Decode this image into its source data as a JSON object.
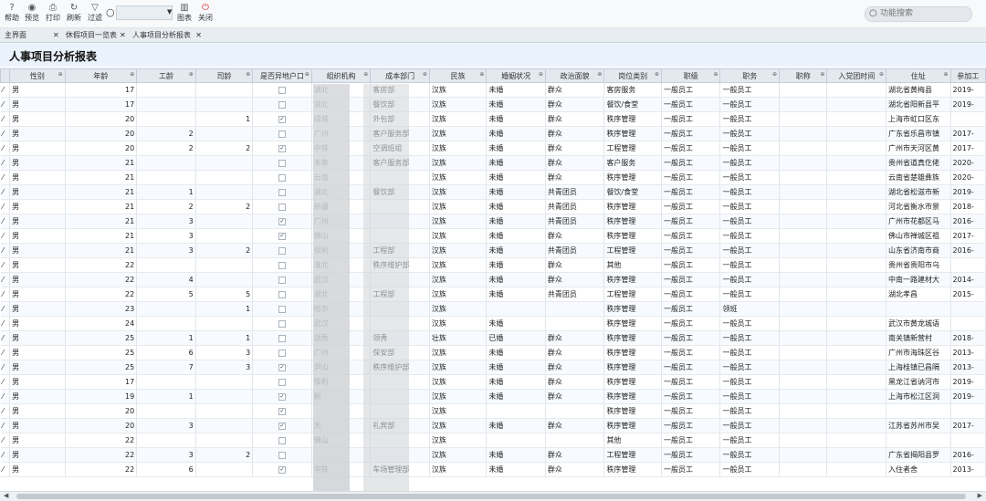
{
  "toolbar": {
    "buttons": [
      {
        "icon": "help-icon",
        "label": "帮助"
      },
      {
        "icon": "preview-icon",
        "label": "预览"
      },
      {
        "icon": "print-icon",
        "label": "打印"
      },
      {
        "icon": "refresh-icon",
        "label": "刷新"
      },
      {
        "icon": "filter-icon",
        "label": "过滤"
      }
    ],
    "chart_label": "图表",
    "close_label": "关闭",
    "search_placeholder": "功能搜索"
  },
  "tabs": [
    {
      "label": "主界面",
      "closable": false
    },
    {
      "label": "休假项目一览表",
      "closable": true
    },
    {
      "label": "人事项目分析报表",
      "closable": true,
      "active": true
    }
  ],
  "report_title": "人事项目分析报表",
  "columns": [
    "性别",
    "年龄",
    "工龄",
    "司龄",
    "是否异地户口",
    "组织机构",
    "成本部门",
    "民族",
    "婚姻状况",
    "政治面貌",
    "岗位类别",
    "职级",
    "职务",
    "职称",
    "入党团时间",
    "住址",
    "参加工"
  ],
  "rows": [
    {
      "sex": "男",
      "age": "17",
      "gongling": "",
      "siling": "",
      "remote": false,
      "org": "湖北",
      "dept": "客房部",
      "nation": "汉族",
      "marital": "未婚",
      "political": "群众",
      "postcat": "客房服务",
      "grade": "一般员工",
      "duty": "一般员工",
      "title": "",
      "partytime": "",
      "addr": "湖北省黄梅县",
      "join": "2019-"
    },
    {
      "sex": "男",
      "age": "17",
      "gongling": "",
      "siling": "",
      "remote": false,
      "org": "湖北",
      "dept": "餐饮部",
      "nation": "汉族",
      "marital": "未婚",
      "political": "群众",
      "postcat": "餐饮/食堂",
      "grade": "一般员工",
      "duty": "一般员工",
      "title": "",
      "partytime": "",
      "addr": "湖北省阳新县平",
      "join": "2019-"
    },
    {
      "sex": "男",
      "age": "20",
      "gongling": "",
      "siling": "1",
      "remote": true,
      "org": "绿城",
      "dept": "外包部",
      "nation": "汉族",
      "marital": "未婚",
      "political": "群众",
      "postcat": "秩序管理",
      "grade": "一般员工",
      "duty": "一般员工",
      "title": "",
      "partytime": "",
      "addr": "上海市虹口区东",
      "join": ""
    },
    {
      "sex": "男",
      "age": "20",
      "gongling": "2",
      "siling": "",
      "remote": false,
      "org": "广州",
      "dept": "客户服务部",
      "nation": "汉族",
      "marital": "未婚",
      "political": "群众",
      "postcat": "秩序管理",
      "grade": "一般员工",
      "duty": "一般员工",
      "title": "",
      "partytime": "",
      "addr": "广东省乐昌市镇",
      "join": "2017-"
    },
    {
      "sex": "男",
      "age": "20",
      "gongling": "2",
      "siling": "2",
      "remote": true,
      "org": "中铁",
      "dept": "空调班组",
      "nation": "汉族",
      "marital": "未婚",
      "political": "群众",
      "postcat": "工程管理",
      "grade": "一般员工",
      "duty": "一般员工",
      "title": "",
      "partytime": "",
      "addr": "广州市天河区黄",
      "join": "2017-"
    },
    {
      "sex": "男",
      "age": "21",
      "gongling": "",
      "siling": "",
      "remote": false,
      "org": "未来",
      "dept": "客户服务部",
      "nation": "汉族",
      "marital": "未婚",
      "political": "群众",
      "postcat": "客户服务",
      "grade": "一般员工",
      "duty": "一般员工",
      "title": "",
      "partytime": "",
      "addr": "贵州省道真仡佬",
      "join": "2020-"
    },
    {
      "sex": "男",
      "age": "21",
      "gongling": "",
      "siling": "",
      "remote": false,
      "org": "云南",
      "dept": "",
      "nation": "汉族",
      "marital": "未婚",
      "political": "群众",
      "postcat": "秩序管理",
      "grade": "一般员工",
      "duty": "一般员工",
      "title": "",
      "partytime": "",
      "addr": "云南省楚雄彝族",
      "join": "2020-"
    },
    {
      "sex": "男",
      "age": "21",
      "gongling": "1",
      "siling": "",
      "remote": false,
      "org": "湖北",
      "dept": "餐饮部",
      "nation": "汉族",
      "marital": "未婚",
      "political": "共青团员",
      "postcat": "餐饮/食堂",
      "grade": "一般员工",
      "duty": "一般员工",
      "title": "",
      "partytime": "",
      "addr": "湖北省松滋市新",
      "join": "2019-"
    },
    {
      "sex": "男",
      "age": "21",
      "gongling": "2",
      "siling": "2",
      "remote": false,
      "org": "新疆",
      "dept": "",
      "nation": "汉族",
      "marital": "未婚",
      "political": "共青团员",
      "postcat": "秩序管理",
      "grade": "一般员工",
      "duty": "一般员工",
      "title": "",
      "partytime": "",
      "addr": "河北省衡水市景",
      "join": "2018-"
    },
    {
      "sex": "男",
      "age": "21",
      "gongling": "3",
      "siling": "",
      "remote": true,
      "org": "广州",
      "dept": "",
      "nation": "汉族",
      "marital": "未婚",
      "political": "共青团员",
      "postcat": "秩序管理",
      "grade": "一般员工",
      "duty": "一般员工",
      "title": "",
      "partytime": "",
      "addr": "广州市花都区马",
      "join": "2016-"
    },
    {
      "sex": "男",
      "age": "21",
      "gongling": "3",
      "siling": "",
      "remote": true,
      "org": "佛山",
      "dept": "",
      "nation": "汉族",
      "marital": "未婚",
      "political": "群众",
      "postcat": "秩序管理",
      "grade": "一般员工",
      "duty": "一般员工",
      "title": "",
      "partytime": "",
      "addr": "佛山市禅城区祖",
      "join": "2017-"
    },
    {
      "sex": "男",
      "age": "21",
      "gongling": "3",
      "siling": "2",
      "remote": false,
      "org": "保利",
      "dept": "工程部",
      "nation": "汉族",
      "marital": "未婚",
      "political": "共青团员",
      "postcat": "工程管理",
      "grade": "一般员工",
      "duty": "一般员工",
      "title": "",
      "partytime": "",
      "addr": "山东省济南市商",
      "join": "2016-"
    },
    {
      "sex": "男",
      "age": "22",
      "gongling": "",
      "siling": "",
      "remote": false,
      "org": "淮北",
      "dept": "秩序维护部",
      "nation": "汉族",
      "marital": "未婚",
      "political": "群众",
      "postcat": "其他",
      "grade": "一般员工",
      "duty": "一般员工",
      "title": "",
      "partytime": "",
      "addr": "贵州省贵阳市乌",
      "join": ""
    },
    {
      "sex": "男",
      "age": "22",
      "gongling": "4",
      "siling": "",
      "remote": false,
      "org": "武汉",
      "dept": "",
      "nation": "汉族",
      "marital": "未婚",
      "political": "群众",
      "postcat": "秩序管理",
      "grade": "一般员工",
      "duty": "一般员工",
      "title": "",
      "partytime": "",
      "addr": "中南一路建材大",
      "join": "2014-"
    },
    {
      "sex": "男",
      "age": "22",
      "gongling": "5",
      "siling": "5",
      "remote": false,
      "org": "湖北",
      "dept": "工程部",
      "nation": "汉族",
      "marital": "未婚",
      "political": "共青团员",
      "postcat": "工程管理",
      "grade": "一般员工",
      "duty": "一般员工",
      "title": "",
      "partytime": "",
      "addr": "湖北孝昌",
      "join": "2015-"
    },
    {
      "sex": "男",
      "age": "23",
      "gongling": "",
      "siling": "1",
      "remote": false,
      "org": "哈尔",
      "dept": "",
      "nation": "汉族",
      "marital": "",
      "political": "",
      "postcat": "秩序管理",
      "grade": "一般员工",
      "duty": "领班",
      "title": "",
      "partytime": "",
      "addr": "",
      "join": ""
    },
    {
      "sex": "男",
      "age": "24",
      "gongling": "",
      "siling": "",
      "remote": false,
      "org": "武汉",
      "dept": "",
      "nation": "汉族",
      "marital": "未婚",
      "political": "",
      "postcat": "秩序管理",
      "grade": "一般员工",
      "duty": "一般员工",
      "title": "",
      "partytime": "",
      "addr": "武汉市黄龙城语",
      "join": ""
    },
    {
      "sex": "男",
      "age": "25",
      "gongling": "1",
      "siling": "1",
      "remote": false,
      "org": "领秀",
      "dept": "领秀",
      "nation": "壮族",
      "marital": "已婚",
      "political": "群众",
      "postcat": "秩序管理",
      "grade": "一般员工",
      "duty": "一般员工",
      "title": "",
      "partytime": "",
      "addr": "南关镇新营村",
      "join": "2018-"
    },
    {
      "sex": "男",
      "age": "25",
      "gongling": "6",
      "siling": "3",
      "remote": false,
      "org": "广州",
      "dept": "保安部",
      "nation": "汉族",
      "marital": "未婚",
      "political": "群众",
      "postcat": "秩序管理",
      "grade": "一般员工",
      "duty": "一般员工",
      "title": "",
      "partytime": "",
      "addr": "广州市海珠区谷",
      "join": "2013-"
    },
    {
      "sex": "男",
      "age": "25",
      "gongling": "7",
      "siling": "3",
      "remote": true,
      "org": "尹山",
      "dept": "秩序维护部",
      "nation": "汉族",
      "marital": "未婚",
      "political": "群众",
      "postcat": "秩序管理",
      "grade": "一般员工",
      "duty": "一般员工",
      "title": "",
      "partytime": "",
      "addr": "上海桂镇已昌隔",
      "join": "2013-"
    },
    {
      "sex": "男",
      "age": "17",
      "gongling": "",
      "siling": "",
      "remote": false,
      "org": "保利",
      "dept": "",
      "nation": "汉族",
      "marital": "未婚",
      "political": "群众",
      "postcat": "秩序管理",
      "grade": "一般员工",
      "duty": "一般员工",
      "title": "",
      "partytime": "",
      "addr": "黑龙江省讷河市",
      "join": "2019-"
    },
    {
      "sex": "男",
      "age": "19",
      "gongling": "1",
      "siling": "",
      "remote": true,
      "org": "新",
      "dept": "",
      "nation": "汉族",
      "marital": "未婚",
      "political": "群众",
      "postcat": "秩序管理",
      "grade": "一般员工",
      "duty": "一般员工",
      "title": "",
      "partytime": "",
      "addr": "上海市松江区洞",
      "join": "2019-"
    },
    {
      "sex": "男",
      "age": "20",
      "gongling": "",
      "siling": "",
      "remote": true,
      "org": "",
      "dept": "",
      "nation": "汉族",
      "marital": "",
      "political": "",
      "postcat": "秩序管理",
      "grade": "一般员工",
      "duty": "一般员工",
      "title": "",
      "partytime": "",
      "addr": "",
      "join": ""
    },
    {
      "sex": "男",
      "age": "20",
      "gongling": "3",
      "siling": "",
      "remote": true,
      "org": "天",
      "dept": "礼宾部",
      "nation": "汉族",
      "marital": "未婚",
      "political": "群众",
      "postcat": "秩序管理",
      "grade": "一般员工",
      "duty": "一般员工",
      "title": "",
      "partytime": "",
      "addr": "江苏省苏州市吴",
      "join": "2017-"
    },
    {
      "sex": "男",
      "age": "22",
      "gongling": "",
      "siling": "",
      "remote": false,
      "org": "佛山",
      "dept": "",
      "nation": "汉族",
      "marital": "",
      "political": "",
      "postcat": "其他",
      "grade": "一般员工",
      "duty": "一般员工",
      "title": "",
      "partytime": "",
      "addr": "",
      "join": ""
    },
    {
      "sex": "男",
      "age": "22",
      "gongling": "3",
      "siling": "2",
      "remote": false,
      "org": "",
      "dept": "",
      "nation": "汉族",
      "marital": "未婚",
      "political": "群众",
      "postcat": "工程管理",
      "grade": "一般员工",
      "duty": "一般员工",
      "title": "",
      "partytime": "",
      "addr": "广东省揭阳县罗",
      "join": "2016-"
    },
    {
      "sex": "男",
      "age": "22",
      "gongling": "6",
      "siling": "",
      "remote": true,
      "org": "中铁",
      "dept": "车场管理部",
      "nation": "汉族",
      "marital": "未婚",
      "political": "群众",
      "postcat": "秩序管理",
      "grade": "一般员工",
      "duty": "一般员工",
      "title": "",
      "partytime": "",
      "addr": "入住者舍",
      "join": "2013-"
    }
  ]
}
